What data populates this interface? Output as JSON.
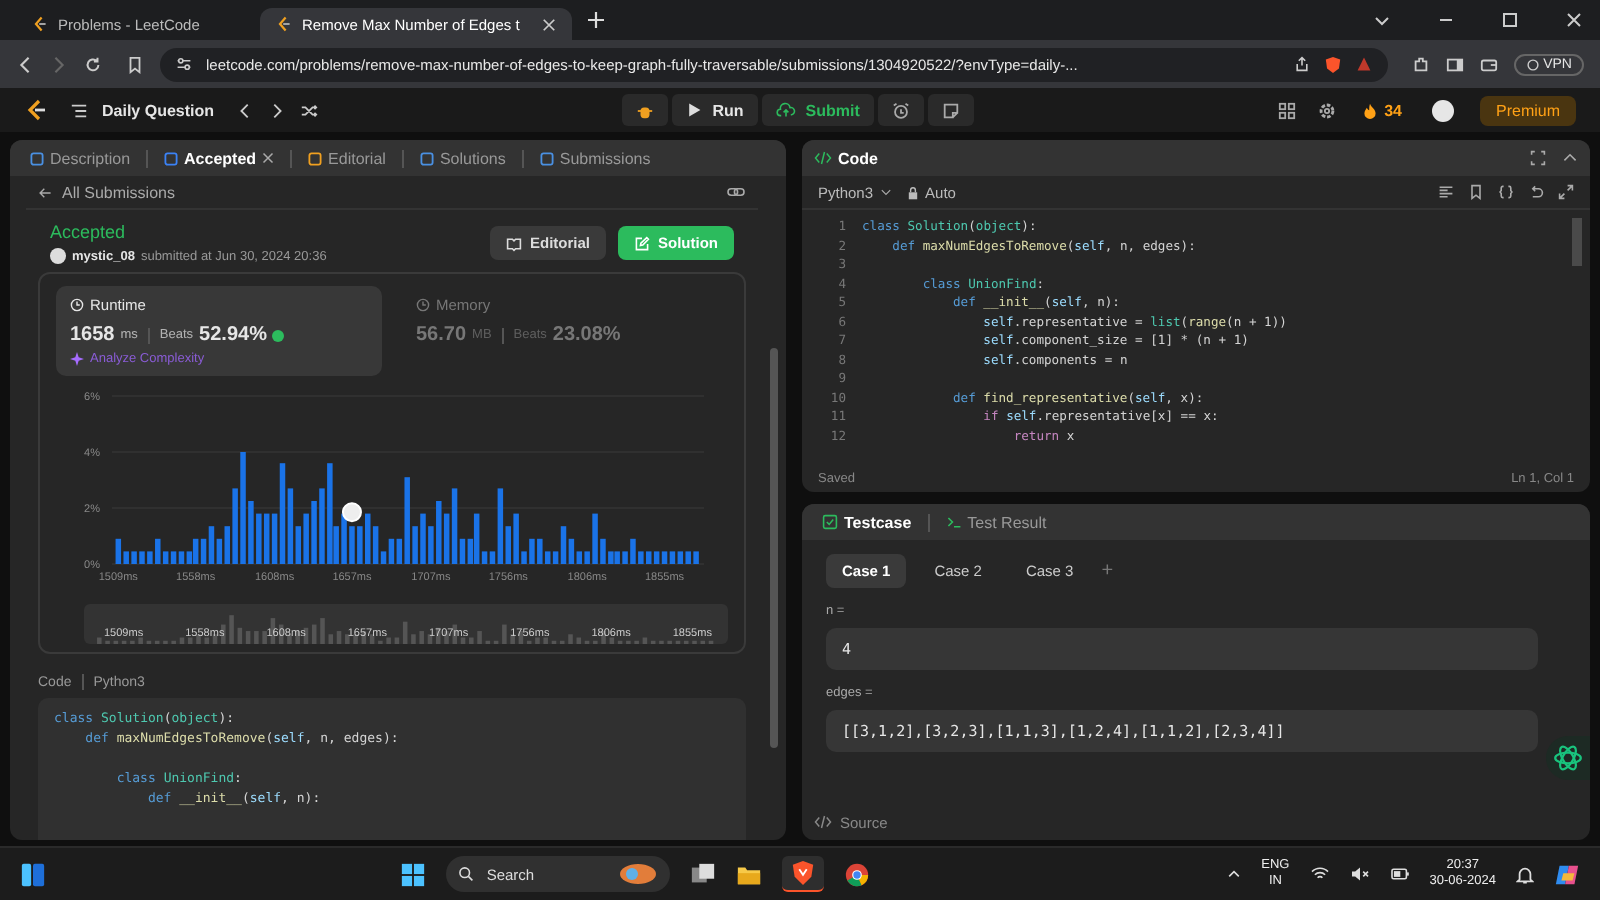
{
  "browser": {
    "tabs": [
      {
        "title": "Problems - LeetCode",
        "selected": false
      },
      {
        "title": "Remove Max Number of Edges t",
        "selected": true
      }
    ],
    "url": "leetcode.com/problems/remove-max-number-of-edges-to-keep-graph-fully-traversable/submissions/1304920522/?envType=daily-...",
    "vpn": "VPN"
  },
  "nav": {
    "title": "Daily Question",
    "run": "Run",
    "submit": "Submit",
    "streak": "34",
    "premium": "Premium"
  },
  "left_tabs": [
    {
      "label": "Description",
      "selected": false,
      "closable": false
    },
    {
      "label": "Accepted",
      "selected": true,
      "closable": true
    },
    {
      "label": "Editorial",
      "selected": false,
      "closable": false
    },
    {
      "label": "Solutions",
      "selected": false,
      "closable": false
    },
    {
      "label": "Submissions",
      "selected": false,
      "closable": false
    }
  ],
  "submission": {
    "back": "All Submissions",
    "status": "Accepted",
    "user": "mystic_08",
    "submitted": "submitted at Jun 30, 2024 20:36",
    "editorial_button": "Editorial",
    "solution_button": "Solution"
  },
  "stats": [
    {
      "title": "Runtime",
      "value": "1658",
      "unit": "ms",
      "beats_label": "Beats",
      "beats": "52.94%",
      "selected": true,
      "extra": "Analyze Complexity"
    },
    {
      "title": "Memory",
      "value": "56.70",
      "unit": "MB",
      "beats_label": "Beats",
      "beats": "23.08%",
      "selected": false
    }
  ],
  "chart": {
    "chart_data": {
      "type": "bar",
      "xlim": [
        1505,
        1880
      ],
      "ylim": [
        0,
        6
      ],
      "yticks": [
        {
          "value": 0,
          "label": "0%"
        },
        {
          "value": 2,
          "label": "2%"
        },
        {
          "value": 4,
          "label": "4%"
        },
        {
          "value": 6,
          "label": "6%"
        }
      ],
      "xticks": [
        {
          "value": 1509,
          "label": "1509ms"
        },
        {
          "value": 1558,
          "label": "1558ms"
        },
        {
          "value": 1608,
          "label": "1608ms"
        },
        {
          "value": 1657,
          "label": "1657ms"
        },
        {
          "value": 1707,
          "label": "1707ms"
        },
        {
          "value": 1756,
          "label": "1756ms"
        },
        {
          "value": 1806,
          "label": "1806ms"
        },
        {
          "value": 1855,
          "label": "1855ms"
        }
      ],
      "x": [
        1509,
        1514,
        1519,
        1524,
        1529,
        1534,
        1539,
        1544,
        1549,
        1554,
        1558,
        1563,
        1568,
        1573,
        1578,
        1583,
        1588,
        1593,
        1598,
        1603,
        1608,
        1613,
        1618,
        1623,
        1628,
        1633,
        1638,
        1643,
        1647,
        1652,
        1657,
        1662,
        1667,
        1672,
        1677,
        1682,
        1687,
        1692,
        1697,
        1702,
        1707,
        1712,
        1717,
        1722,
        1727,
        1732,
        1736,
        1741,
        1746,
        1751,
        1756,
        1761,
        1766,
        1771,
        1776,
        1781,
        1786,
        1791,
        1796,
        1801,
        1806,
        1811,
        1816,
        1821,
        1825,
        1830,
        1835,
        1840,
        1845,
        1850,
        1855,
        1860,
        1865,
        1870,
        1875
      ],
      "values": [
        0.9,
        0.45,
        0.45,
        0.45,
        0.45,
        0.9,
        0.45,
        0.45,
        0.45,
        0.45,
        0.9,
        0.9,
        1.35,
        0.9,
        1.35,
        2.7,
        4.0,
        2.25,
        1.8,
        1.8,
        1.8,
        3.6,
        2.7,
        1.35,
        1.8,
        2.25,
        2.7,
        3.6,
        1.35,
        1.8,
        1.35,
        1.35,
        1.8,
        1.35,
        0.45,
        0.9,
        0.9,
        3.1,
        1.35,
        1.8,
        1.35,
        2.25,
        1.8,
        2.7,
        0.9,
        0.9,
        1.8,
        0.45,
        0.45,
        2.7,
        1.35,
        1.8,
        0.45,
        0.9,
        0.9,
        0.45,
        0.45,
        1.35,
        0.9,
        0.45,
        0.45,
        1.8,
        0.9,
        0.45,
        0.45,
        0.45,
        0.9,
        0.45,
        0.45,
        0.45,
        0.45,
        0.45,
        0.45,
        0.45,
        0.45
      ]
    },
    "overview_labels": [
      "1509ms",
      "1558ms",
      "1608ms",
      "1657ms",
      "1707ms",
      "1756ms",
      "1806ms",
      "1855ms"
    ]
  },
  "code_view": {
    "label": "Code",
    "language": "Python3",
    "lines": [
      {
        "text": "class Solution(object):"
      },
      {
        "text": "    def maxNumEdgesToRemove(self, n, edges):"
      },
      {
        "text": "        class UnionFind:",
        "gap_before": true
      },
      {
        "text": "            def __init__(self, n):"
      }
    ]
  },
  "editor": {
    "title": "Code",
    "language": "Python3",
    "mode": "Auto",
    "status": "Saved",
    "cursor": "Ln 1, Col 1",
    "lines": [
      {
        "no": "1",
        "text": "class Solution(object):"
      },
      {
        "no": "2",
        "text": "    def maxNumEdgesToRemove(self, n, edges):"
      },
      {
        "no": "3"
      },
      {
        "no": "4",
        "text": "        class UnionFind:"
      },
      {
        "no": "5",
        "text": "            def __init__(self, n):"
      },
      {
        "no": "6",
        "text": "                self.representative = list(range(n + 1))"
      },
      {
        "no": "7",
        "text": "                self.component_size = [1] * (n + 1)"
      },
      {
        "no": "8",
        "text": "                self.components = n"
      },
      {
        "no": "9"
      },
      {
        "no": "10",
        "text": "            def find_representative(self, x):"
      },
      {
        "no": "11",
        "text": "                if self.representative[x] == x:"
      },
      {
        "no": "12",
        "text": "                    return x"
      }
    ]
  },
  "testcase": {
    "tabs": [
      {
        "label": "Testcase",
        "selected": true
      },
      {
        "label": "Test Result",
        "selected": false
      }
    ],
    "cases": [
      {
        "label": "Case 1",
        "selected": true
      },
      {
        "label": "Case 2",
        "selected": false
      },
      {
        "label": "Case 3",
        "selected": false
      }
    ],
    "add": "+",
    "params": [
      {
        "name": "n =",
        "value": "4"
      },
      {
        "name": "edges =",
        "value": "[[3,1,2],[3,2,3],[1,1,3],[1,2,4],[1,1,2],[2,3,4]]"
      }
    ],
    "source": "Source"
  },
  "taskbar": {
    "search": "Search",
    "lang": "ENG",
    "region": "IN",
    "time": "20:37",
    "date": "30-06-2024"
  }
}
